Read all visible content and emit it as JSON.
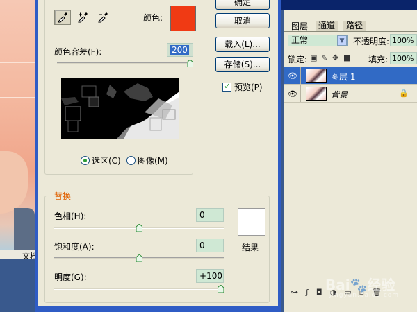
{
  "status_bar": {
    "text": "文档"
  },
  "dialog": {
    "color_label": "颜色:",
    "fuzz_label": "颜色容差(F):",
    "fuzz_value": "200",
    "fuzz_level": 1.0,
    "selection_radio": "选区(C)",
    "image_radio": "图像(M)",
    "ok_button": "确定",
    "cancel_button": "取消",
    "load_button": "载入(L)...",
    "save_button": "存储(S)...",
    "preview_label": "预览(P)",
    "replace_legend": "替换",
    "hue_label": "色相(H):",
    "hue_value": "0",
    "saturation_label": "饱和度(A):",
    "saturation_value": "0",
    "lightness_label": "明度(G):",
    "lightness_value": "+100",
    "result_label": "结果",
    "colors": {
      "sample": "#f03a14",
      "result": "#ffffff",
      "accent": "#e06000"
    }
  },
  "layers_panel": {
    "tabs": [
      "图层",
      "通道",
      "路径"
    ],
    "blend_mode": "正常",
    "opacity_label": "不透明度:",
    "opacity_value": "100%",
    "lock_label": "锁定:",
    "fill_label": "填充:",
    "fill_value": "100%",
    "layers": [
      {
        "name": "图层 1",
        "selected": true
      },
      {
        "name": "背景",
        "selected": false,
        "locked": true
      }
    ]
  },
  "watermark": {
    "brand": "Bai",
    "brand_cn": "经验",
    "url": "jingyan.baidu.com"
  }
}
